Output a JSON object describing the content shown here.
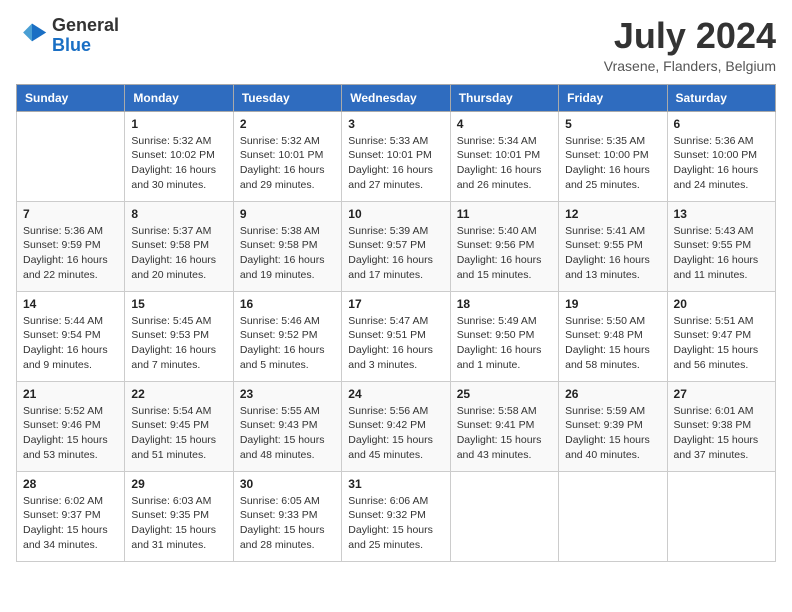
{
  "header": {
    "logo_line1": "General",
    "logo_line2": "Blue",
    "month": "July 2024",
    "location": "Vrasene, Flanders, Belgium"
  },
  "weekdays": [
    "Sunday",
    "Monday",
    "Tuesday",
    "Wednesday",
    "Thursday",
    "Friday",
    "Saturday"
  ],
  "weeks": [
    [
      {
        "day": "",
        "info": ""
      },
      {
        "day": "1",
        "info": "Sunrise: 5:32 AM\nSunset: 10:02 PM\nDaylight: 16 hours\nand 30 minutes."
      },
      {
        "day": "2",
        "info": "Sunrise: 5:32 AM\nSunset: 10:01 PM\nDaylight: 16 hours\nand 29 minutes."
      },
      {
        "day": "3",
        "info": "Sunrise: 5:33 AM\nSunset: 10:01 PM\nDaylight: 16 hours\nand 27 minutes."
      },
      {
        "day": "4",
        "info": "Sunrise: 5:34 AM\nSunset: 10:01 PM\nDaylight: 16 hours\nand 26 minutes."
      },
      {
        "day": "5",
        "info": "Sunrise: 5:35 AM\nSunset: 10:00 PM\nDaylight: 16 hours\nand 25 minutes."
      },
      {
        "day": "6",
        "info": "Sunrise: 5:36 AM\nSunset: 10:00 PM\nDaylight: 16 hours\nand 24 minutes."
      }
    ],
    [
      {
        "day": "7",
        "info": "Sunrise: 5:36 AM\nSunset: 9:59 PM\nDaylight: 16 hours\nand 22 minutes."
      },
      {
        "day": "8",
        "info": "Sunrise: 5:37 AM\nSunset: 9:58 PM\nDaylight: 16 hours\nand 20 minutes."
      },
      {
        "day": "9",
        "info": "Sunrise: 5:38 AM\nSunset: 9:58 PM\nDaylight: 16 hours\nand 19 minutes."
      },
      {
        "day": "10",
        "info": "Sunrise: 5:39 AM\nSunset: 9:57 PM\nDaylight: 16 hours\nand 17 minutes."
      },
      {
        "day": "11",
        "info": "Sunrise: 5:40 AM\nSunset: 9:56 PM\nDaylight: 16 hours\nand 15 minutes."
      },
      {
        "day": "12",
        "info": "Sunrise: 5:41 AM\nSunset: 9:55 PM\nDaylight: 16 hours\nand 13 minutes."
      },
      {
        "day": "13",
        "info": "Sunrise: 5:43 AM\nSunset: 9:55 PM\nDaylight: 16 hours\nand 11 minutes."
      }
    ],
    [
      {
        "day": "14",
        "info": "Sunrise: 5:44 AM\nSunset: 9:54 PM\nDaylight: 16 hours\nand 9 minutes."
      },
      {
        "day": "15",
        "info": "Sunrise: 5:45 AM\nSunset: 9:53 PM\nDaylight: 16 hours\nand 7 minutes."
      },
      {
        "day": "16",
        "info": "Sunrise: 5:46 AM\nSunset: 9:52 PM\nDaylight: 16 hours\nand 5 minutes."
      },
      {
        "day": "17",
        "info": "Sunrise: 5:47 AM\nSunset: 9:51 PM\nDaylight: 16 hours\nand 3 minutes."
      },
      {
        "day": "18",
        "info": "Sunrise: 5:49 AM\nSunset: 9:50 PM\nDaylight: 16 hours\nand 1 minute."
      },
      {
        "day": "19",
        "info": "Sunrise: 5:50 AM\nSunset: 9:48 PM\nDaylight: 15 hours\nand 58 minutes."
      },
      {
        "day": "20",
        "info": "Sunrise: 5:51 AM\nSunset: 9:47 PM\nDaylight: 15 hours\nand 56 minutes."
      }
    ],
    [
      {
        "day": "21",
        "info": "Sunrise: 5:52 AM\nSunset: 9:46 PM\nDaylight: 15 hours\nand 53 minutes."
      },
      {
        "day": "22",
        "info": "Sunrise: 5:54 AM\nSunset: 9:45 PM\nDaylight: 15 hours\nand 51 minutes."
      },
      {
        "day": "23",
        "info": "Sunrise: 5:55 AM\nSunset: 9:43 PM\nDaylight: 15 hours\nand 48 minutes."
      },
      {
        "day": "24",
        "info": "Sunrise: 5:56 AM\nSunset: 9:42 PM\nDaylight: 15 hours\nand 45 minutes."
      },
      {
        "day": "25",
        "info": "Sunrise: 5:58 AM\nSunset: 9:41 PM\nDaylight: 15 hours\nand 43 minutes."
      },
      {
        "day": "26",
        "info": "Sunrise: 5:59 AM\nSunset: 9:39 PM\nDaylight: 15 hours\nand 40 minutes."
      },
      {
        "day": "27",
        "info": "Sunrise: 6:01 AM\nSunset: 9:38 PM\nDaylight: 15 hours\nand 37 minutes."
      }
    ],
    [
      {
        "day": "28",
        "info": "Sunrise: 6:02 AM\nSunset: 9:37 PM\nDaylight: 15 hours\nand 34 minutes."
      },
      {
        "day": "29",
        "info": "Sunrise: 6:03 AM\nSunset: 9:35 PM\nDaylight: 15 hours\nand 31 minutes."
      },
      {
        "day": "30",
        "info": "Sunrise: 6:05 AM\nSunset: 9:33 PM\nDaylight: 15 hours\nand 28 minutes."
      },
      {
        "day": "31",
        "info": "Sunrise: 6:06 AM\nSunset: 9:32 PM\nDaylight: 15 hours\nand 25 minutes."
      },
      {
        "day": "",
        "info": ""
      },
      {
        "day": "",
        "info": ""
      },
      {
        "day": "",
        "info": ""
      }
    ]
  ]
}
